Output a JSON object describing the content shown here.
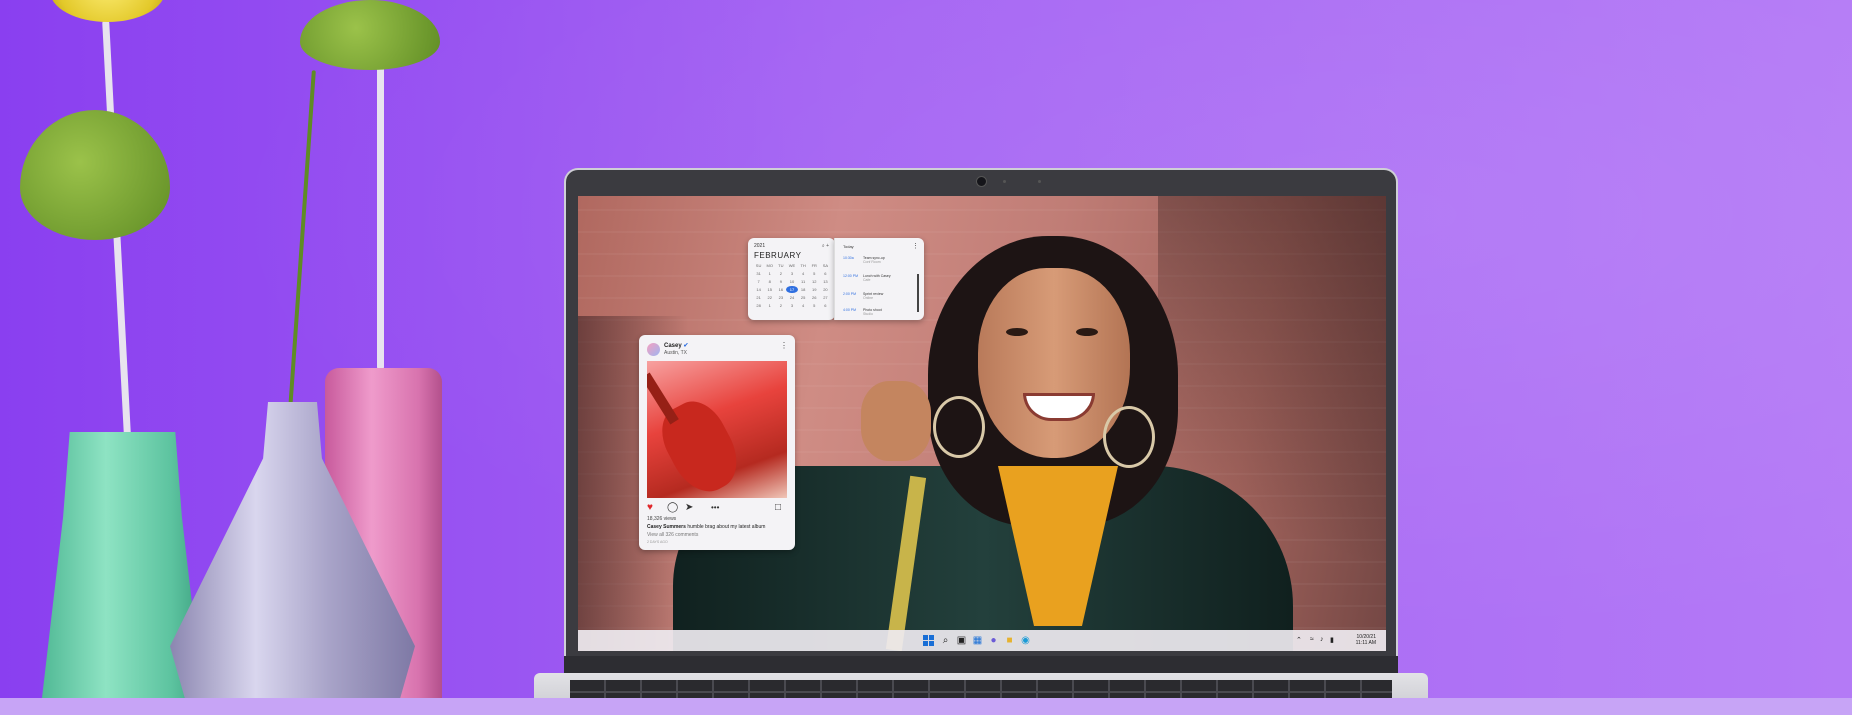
{
  "calendar_widget": {
    "year": "2021",
    "month": "FEBRUARY",
    "weekdays": [
      "SU",
      "MO",
      "TU",
      "WE",
      "TH",
      "FR",
      "SA"
    ],
    "days": [
      "31",
      "1",
      "2",
      "3",
      "4",
      "5",
      "6",
      "7",
      "8",
      "9",
      "10",
      "11",
      "12",
      "13",
      "14",
      "15",
      "16",
      "17",
      "18",
      "19",
      "20",
      "21",
      "22",
      "23",
      "24",
      "25",
      "26",
      "27",
      "28",
      "1",
      "2",
      "3",
      "4",
      "5",
      "6"
    ],
    "today": "17",
    "icons": [
      "search-icon",
      "add-icon"
    ]
  },
  "agenda_widget": {
    "heading": "Today",
    "events": [
      {
        "time": "10:30a",
        "title": "Team sync-up",
        "sub": "Conf Room"
      },
      {
        "time": "12:00 PM",
        "title": "Lunch with Casey",
        "sub": "Cafe"
      },
      {
        "time": "2:00 PM",
        "title": "Sprint review",
        "sub": "Online"
      },
      {
        "time": "4:00 PM",
        "title": "Photo shoot",
        "sub": "Studio"
      }
    ]
  },
  "social_post": {
    "user_name": "Casey",
    "location": "Austin, TX",
    "views": "18,326 views",
    "caption_user": "Casey Summers",
    "caption_text": "humble brag about my latest album",
    "comments": "View all 326 comments",
    "age": "2 DAYS AGO",
    "colors": {
      "like": "#e0262a"
    }
  },
  "taskbar": {
    "apps": [
      "start-icon",
      "search-icon",
      "task-view-icon",
      "widgets-icon",
      "chat-icon",
      "file-explorer-icon",
      "edge-icon"
    ],
    "tray": {
      "date": "10/20/21",
      "time": "11:11 AM"
    },
    "colors": {
      "accent": "#1a6fd6"
    }
  }
}
